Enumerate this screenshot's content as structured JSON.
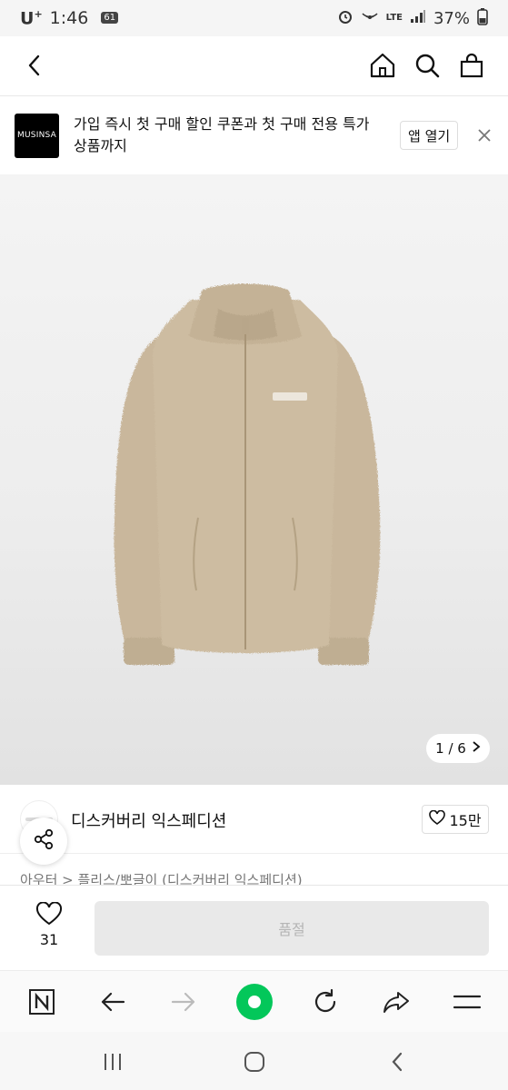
{
  "status_bar": {
    "carrier": "U",
    "carrier_sup": "+",
    "time": "1:46",
    "badge": "61",
    "network": "LTE",
    "battery": "37%"
  },
  "promo": {
    "logo_text": "MUSINSA",
    "message": "가입 즉시 첫 구매 할인 쿠폰과 첫 구매 전용 특가 상품까지",
    "open_app_label": "앱 열기"
  },
  "gallery": {
    "pager_text": "1 / 6"
  },
  "brand": {
    "name": "디스커버리 익스페디션",
    "like_count": "15만"
  },
  "breadcrumb": "아우터 > 플리스/뽀글이 (디스커버리 익스페디션)",
  "buy_bar": {
    "wish_count": "31",
    "soldout_label": "품절"
  },
  "colors": {
    "jacket": "#c9b79c",
    "browser_green": "#03c75a"
  }
}
